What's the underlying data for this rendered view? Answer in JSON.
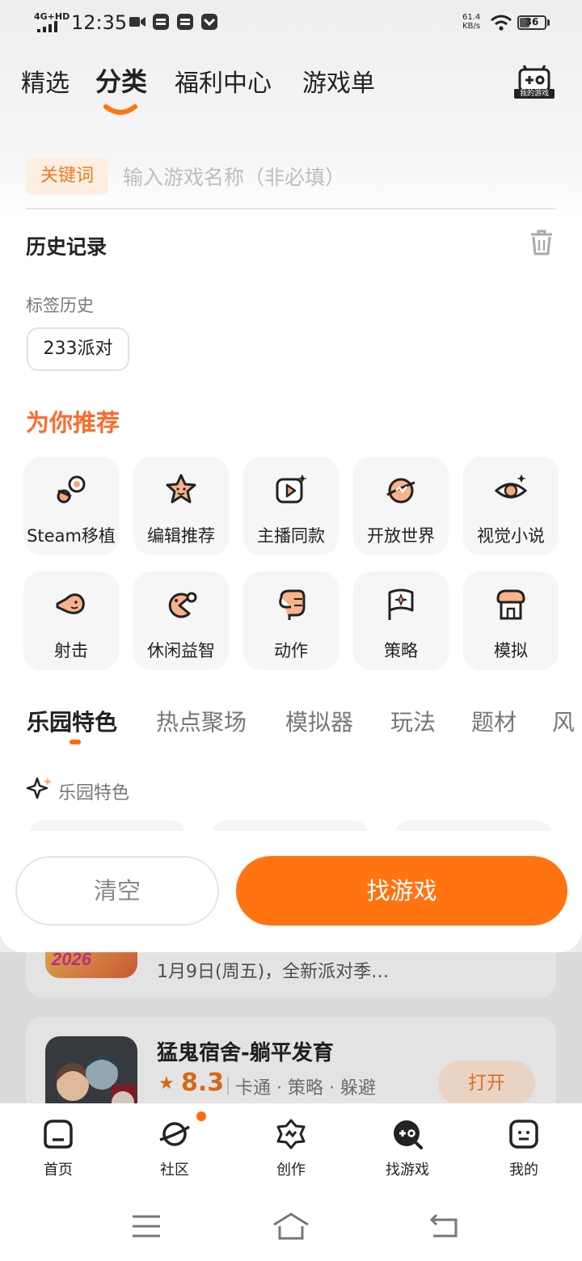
{
  "status_bar": {
    "network": "4G+HD",
    "time": "12:35",
    "speed_value": "61.4",
    "speed_unit": "KB/s",
    "battery": "36"
  },
  "top_tabs": [
    "精选",
    "分类",
    "福利中心",
    "游戏单"
  ],
  "active_top_tab": "分类",
  "my_games_label": "我的游戏",
  "search": {
    "keyword_chip": "关键词",
    "placeholder": "输入游戏名称（非必填）"
  },
  "history": {
    "title": "历史记录",
    "tag_history_label": "标签历史",
    "tags": [
      "233派对"
    ]
  },
  "recommend": {
    "title": "为你推荐",
    "categories": [
      {
        "label": "Steam移植",
        "icon": "steam-icon"
      },
      {
        "label": "编辑推荐",
        "icon": "star-face-icon"
      },
      {
        "label": "主播同款",
        "icon": "video-play-icon"
      },
      {
        "label": "开放世界",
        "icon": "planet-icon"
      },
      {
        "label": "视觉小说",
        "icon": "eye-icon"
      },
      {
        "label": "射击",
        "icon": "shooter-face-icon"
      },
      {
        "label": "休闲益智",
        "icon": "pacman-icon"
      },
      {
        "label": "动作",
        "icon": "fist-icon"
      },
      {
        "label": "策略",
        "icon": "flag-icon"
      },
      {
        "label": "模拟",
        "icon": "shop-icon"
      }
    ]
  },
  "section_tabs": [
    "乐园特色",
    "热点聚场",
    "模拟器",
    "玩法",
    "题材",
    "风"
  ],
  "active_section_tab": "乐园特色",
  "feature_label": "乐园特色",
  "buttons": {
    "clear": "清空",
    "find": "找游戏"
  },
  "background_feed": {
    "card1_text": "1月9日(周五)，全新派对季…",
    "card1_icon_text": "2026",
    "game": {
      "title": "猛鬼宿舍-躺平发育",
      "rating": "8.3",
      "tags": "卡通 · 策略 · 躲避",
      "action": "打开"
    }
  },
  "bottom_nav": [
    {
      "label": "首页",
      "icon": "home-icon"
    },
    {
      "label": "社区",
      "icon": "planet-community-icon"
    },
    {
      "label": "创作",
      "icon": "create-icon"
    },
    {
      "label": "找游戏",
      "icon": "find-game-icon"
    },
    {
      "label": "我的",
      "icon": "profile-icon"
    }
  ],
  "colors": {
    "accent": "#ff7411",
    "recommend_title": "#ff6a2a",
    "chip_bg": "#fdeee2"
  }
}
